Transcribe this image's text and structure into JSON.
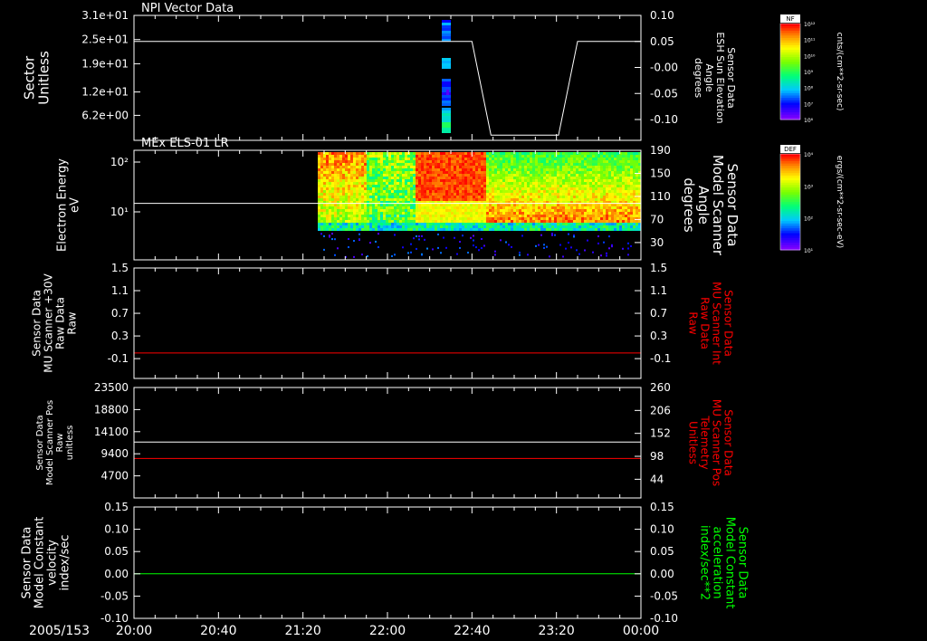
{
  "figure": {
    "date_label": "2005/153",
    "x_tick_labels": [
      "20:00",
      "20:40",
      "21:20",
      "22:00",
      "22:40",
      "23:20",
      "00:00"
    ]
  },
  "colors": {
    "background": "#000000",
    "axis": "#ffffff",
    "red_trace": "#ff0000",
    "green_trace": "#00ff00",
    "white_trace": "#ffffff"
  },
  "chart_data": [
    {
      "type": "heatmap",
      "title": "NPI Vector Data",
      "ylabel": [
        "Sector",
        "Unitless"
      ],
      "y_tick_labels": [
        "3.1e+01",
        "2.5e+01",
        "1.9e+01",
        "1.2e+01",
        "6.2e+00"
      ],
      "ylim": [
        0,
        31
      ],
      "y2label": [
        "Sensor Data",
        "ESH Sun Elevation",
        "Angle",
        "degrees"
      ],
      "y2_tick_labels": [
        "0.10",
        "0.05",
        "-0.00",
        "-0.05",
        "-0.10"
      ],
      "y2lim": [
        -0.14,
        0.1
      ],
      "colorbar": {
        "label": "NF",
        "unit": "cnts/(cm**2-sr-sec)",
        "tick_labels": [
          "10¹²",
          "10¹¹",
          "10¹⁰",
          "10⁹",
          "10⁸",
          "10⁷",
          "10⁶"
        ]
      },
      "series": [
        {
          "name": "Sun Elevation Angle",
          "x": [
            "20:00",
            "22:40",
            "22:49",
            "23:21",
            "23:30",
            "00:00"
          ],
          "values": [
            0.05,
            0.05,
            -0.13,
            -0.13,
            0.05,
            0.05
          ]
        }
      ]
    },
    {
      "type": "heatmap",
      "title": "MEx ELS-01 LR",
      "ylabel": [
        "Electron Energy",
        "eV"
      ],
      "y_tick_labels": [
        "10²",
        "10¹"
      ],
      "yscale": "log",
      "ylim": [
        1,
        200
      ],
      "y2label": [
        "Sensor Data",
        "Model Scanner",
        "Angle",
        "degrees"
      ],
      "y2_tick_labels": [
        "190",
        "150",
        "110",
        "70",
        "30"
      ],
      "y2lim": [
        0,
        190
      ],
      "colorbar": {
        "label": "DEF",
        "unit": "ergs/(cm**2-sr-sec-eV)",
        "tick_labels": [
          "10⁴",
          "10³",
          "10²",
          "10¹"
        ]
      },
      "series": [
        {
          "name": "Model Scanner Angle",
          "x": [
            "20:00",
            "00:00"
          ],
          "values": [
            98,
            98
          ]
        }
      ]
    },
    {
      "type": "line",
      "ylabel": [
        "Sensor Data",
        "MU Scanner +30V",
        "Raw Data",
        "Raw"
      ],
      "y_tick_labels": [
        "1.5",
        "1.1",
        "0.7",
        "0.3",
        "-0.1"
      ],
      "ylim": [
        -0.45,
        1.5
      ],
      "y2label": [
        "Sensor Data",
        "MU Scanner Int",
        "Raw Data",
        "Raw"
      ],
      "y2_tick_labels": [
        "1.5",
        "1.1",
        "0.7",
        "0.3",
        "-0.1"
      ],
      "y2lim": [
        -0.45,
        1.5
      ],
      "series": [
        {
          "name": "MU Scanner Int",
          "x": [
            "20:00",
            "00:00"
          ],
          "values": [
            0.0,
            0.0
          ]
        }
      ]
    },
    {
      "type": "line",
      "ylabel": [
        "Sensor Data",
        "Model Scanner Pos",
        "Raw",
        "unitless"
      ],
      "y_tick_labels": [
        "23500",
        "18800",
        "14100",
        "9400",
        "4700"
      ],
      "ylim": [
        0,
        23500
      ],
      "y2label": [
        "Sensor Data",
        "MU Scanner Pos",
        "Telemetry",
        "Unitless"
      ],
      "y2_tick_labels": [
        "260",
        "206",
        "152",
        "98",
        "44"
      ],
      "y2lim": [
        0,
        260
      ],
      "series": [
        {
          "name": "Model Scanner Pos",
          "x": [
            "20:00",
            "00:00"
          ],
          "values": [
            11900,
            11900
          ]
        },
        {
          "name": "MU Scanner Pos",
          "x": [
            "20:00",
            "00:00"
          ],
          "values": [
            93,
            93
          ]
        }
      ]
    },
    {
      "type": "line",
      "ylabel": [
        "Sensor Data",
        "Model Constant",
        "velocity",
        "index/sec"
      ],
      "y_tick_labels": [
        "0.15",
        "0.10",
        "0.05",
        "0.00",
        "-0.05",
        "-0.10"
      ],
      "ylim": [
        -0.1,
        0.15
      ],
      "y2label": [
        "Sensor Data",
        "Model Constant",
        "acceleration",
        "index/sec**2"
      ],
      "y2_tick_labels": [
        "0.15",
        "0.10",
        "0.05",
        "0.00",
        "-0.05",
        "-0.10"
      ],
      "y2lim": [
        -0.1,
        0.15
      ],
      "series": [
        {
          "name": "Model Constant acceleration",
          "x": [
            "20:00",
            "00:00"
          ],
          "values": [
            0.0,
            0.0
          ]
        }
      ]
    }
  ]
}
